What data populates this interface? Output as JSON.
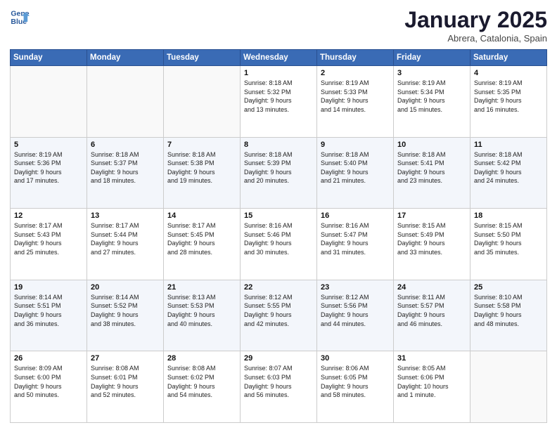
{
  "header": {
    "logo_line1": "General",
    "logo_line2": "Blue",
    "month": "January 2025",
    "location": "Abrera, Catalonia, Spain"
  },
  "weekdays": [
    "Sunday",
    "Monday",
    "Tuesday",
    "Wednesday",
    "Thursday",
    "Friday",
    "Saturday"
  ],
  "weeks": [
    [
      {
        "day": "",
        "info": ""
      },
      {
        "day": "",
        "info": ""
      },
      {
        "day": "",
        "info": ""
      },
      {
        "day": "1",
        "info": "Sunrise: 8:18 AM\nSunset: 5:32 PM\nDaylight: 9 hours\nand 13 minutes."
      },
      {
        "day": "2",
        "info": "Sunrise: 8:19 AM\nSunset: 5:33 PM\nDaylight: 9 hours\nand 14 minutes."
      },
      {
        "day": "3",
        "info": "Sunrise: 8:19 AM\nSunset: 5:34 PM\nDaylight: 9 hours\nand 15 minutes."
      },
      {
        "day": "4",
        "info": "Sunrise: 8:19 AM\nSunset: 5:35 PM\nDaylight: 9 hours\nand 16 minutes."
      }
    ],
    [
      {
        "day": "5",
        "info": "Sunrise: 8:19 AM\nSunset: 5:36 PM\nDaylight: 9 hours\nand 17 minutes."
      },
      {
        "day": "6",
        "info": "Sunrise: 8:18 AM\nSunset: 5:37 PM\nDaylight: 9 hours\nand 18 minutes."
      },
      {
        "day": "7",
        "info": "Sunrise: 8:18 AM\nSunset: 5:38 PM\nDaylight: 9 hours\nand 19 minutes."
      },
      {
        "day": "8",
        "info": "Sunrise: 8:18 AM\nSunset: 5:39 PM\nDaylight: 9 hours\nand 20 minutes."
      },
      {
        "day": "9",
        "info": "Sunrise: 8:18 AM\nSunset: 5:40 PM\nDaylight: 9 hours\nand 21 minutes."
      },
      {
        "day": "10",
        "info": "Sunrise: 8:18 AM\nSunset: 5:41 PM\nDaylight: 9 hours\nand 23 minutes."
      },
      {
        "day": "11",
        "info": "Sunrise: 8:18 AM\nSunset: 5:42 PM\nDaylight: 9 hours\nand 24 minutes."
      }
    ],
    [
      {
        "day": "12",
        "info": "Sunrise: 8:17 AM\nSunset: 5:43 PM\nDaylight: 9 hours\nand 25 minutes."
      },
      {
        "day": "13",
        "info": "Sunrise: 8:17 AM\nSunset: 5:44 PM\nDaylight: 9 hours\nand 27 minutes."
      },
      {
        "day": "14",
        "info": "Sunrise: 8:17 AM\nSunset: 5:45 PM\nDaylight: 9 hours\nand 28 minutes."
      },
      {
        "day": "15",
        "info": "Sunrise: 8:16 AM\nSunset: 5:46 PM\nDaylight: 9 hours\nand 30 minutes."
      },
      {
        "day": "16",
        "info": "Sunrise: 8:16 AM\nSunset: 5:47 PM\nDaylight: 9 hours\nand 31 minutes."
      },
      {
        "day": "17",
        "info": "Sunrise: 8:15 AM\nSunset: 5:49 PM\nDaylight: 9 hours\nand 33 minutes."
      },
      {
        "day": "18",
        "info": "Sunrise: 8:15 AM\nSunset: 5:50 PM\nDaylight: 9 hours\nand 35 minutes."
      }
    ],
    [
      {
        "day": "19",
        "info": "Sunrise: 8:14 AM\nSunset: 5:51 PM\nDaylight: 9 hours\nand 36 minutes."
      },
      {
        "day": "20",
        "info": "Sunrise: 8:14 AM\nSunset: 5:52 PM\nDaylight: 9 hours\nand 38 minutes."
      },
      {
        "day": "21",
        "info": "Sunrise: 8:13 AM\nSunset: 5:53 PM\nDaylight: 9 hours\nand 40 minutes."
      },
      {
        "day": "22",
        "info": "Sunrise: 8:12 AM\nSunset: 5:55 PM\nDaylight: 9 hours\nand 42 minutes."
      },
      {
        "day": "23",
        "info": "Sunrise: 8:12 AM\nSunset: 5:56 PM\nDaylight: 9 hours\nand 44 minutes."
      },
      {
        "day": "24",
        "info": "Sunrise: 8:11 AM\nSunset: 5:57 PM\nDaylight: 9 hours\nand 46 minutes."
      },
      {
        "day": "25",
        "info": "Sunrise: 8:10 AM\nSunset: 5:58 PM\nDaylight: 9 hours\nand 48 minutes."
      }
    ],
    [
      {
        "day": "26",
        "info": "Sunrise: 8:09 AM\nSunset: 6:00 PM\nDaylight: 9 hours\nand 50 minutes."
      },
      {
        "day": "27",
        "info": "Sunrise: 8:08 AM\nSunset: 6:01 PM\nDaylight: 9 hours\nand 52 minutes."
      },
      {
        "day": "28",
        "info": "Sunrise: 8:08 AM\nSunset: 6:02 PM\nDaylight: 9 hours\nand 54 minutes."
      },
      {
        "day": "29",
        "info": "Sunrise: 8:07 AM\nSunset: 6:03 PM\nDaylight: 9 hours\nand 56 minutes."
      },
      {
        "day": "30",
        "info": "Sunrise: 8:06 AM\nSunset: 6:05 PM\nDaylight: 9 hours\nand 58 minutes."
      },
      {
        "day": "31",
        "info": "Sunrise: 8:05 AM\nSunset: 6:06 PM\nDaylight: 10 hours\nand 1 minute."
      },
      {
        "day": "",
        "info": ""
      }
    ]
  ]
}
